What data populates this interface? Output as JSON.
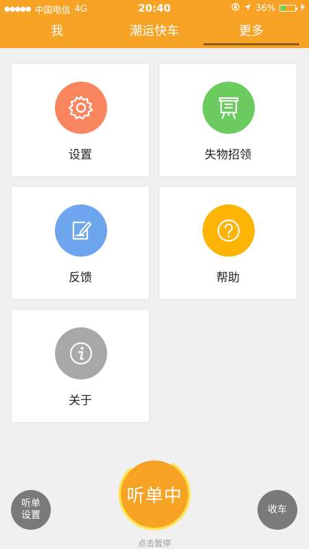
{
  "status_bar": {
    "carrier": "中国电信",
    "network": "4G",
    "time": "20:40",
    "battery": "36%",
    "battery_level": 0.36
  },
  "tabs": [
    {
      "label": "我"
    },
    {
      "label": "潮运快车"
    },
    {
      "label": "更多"
    }
  ],
  "menu": [
    {
      "label": "设置",
      "icon": "gear-icon",
      "color": "#f9855f"
    },
    {
      "label": "失物招领",
      "icon": "lost-found-board-icon",
      "color": "#6ccb5f"
    },
    {
      "label": "反馈",
      "icon": "feedback-edit-icon",
      "color": "#6ea6ee"
    },
    {
      "label": "帮助",
      "icon": "question-icon",
      "color": "#fbb306"
    },
    {
      "label": "关于",
      "icon": "info-icon",
      "color": "#a8a8a8"
    }
  ],
  "bottom": {
    "listen_settings": "听单 设置",
    "listen_button": "听单中",
    "pause_hint": "点击暂停",
    "stop_button": "收车"
  },
  "colors": {
    "accent": "#f6a225",
    "ring": "#ffe14d",
    "grey_button": "#7a7a7a"
  }
}
